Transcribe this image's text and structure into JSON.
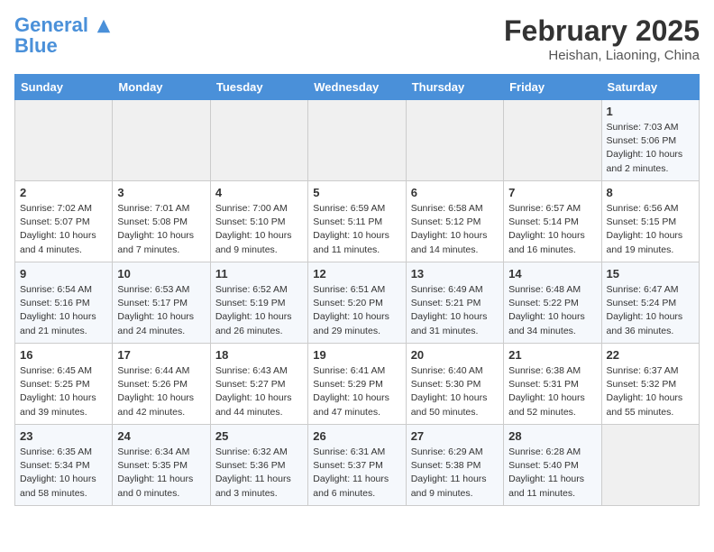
{
  "header": {
    "logo_line1": "General",
    "logo_line2": "Blue",
    "month_year": "February 2025",
    "location": "Heishan, Liaoning, China"
  },
  "weekdays": [
    "Sunday",
    "Monday",
    "Tuesday",
    "Wednesday",
    "Thursday",
    "Friday",
    "Saturday"
  ],
  "weeks": [
    [
      {
        "day": "",
        "empty": true
      },
      {
        "day": "",
        "empty": true
      },
      {
        "day": "",
        "empty": true
      },
      {
        "day": "",
        "empty": true
      },
      {
        "day": "",
        "empty": true
      },
      {
        "day": "",
        "empty": true
      },
      {
        "day": "1",
        "sunrise": "Sunrise: 7:03 AM",
        "sunset": "Sunset: 5:06 PM",
        "daylight": "Daylight: 10 hours and 2 minutes."
      }
    ],
    [
      {
        "day": "2",
        "sunrise": "Sunrise: 7:02 AM",
        "sunset": "Sunset: 5:07 PM",
        "daylight": "Daylight: 10 hours and 4 minutes."
      },
      {
        "day": "3",
        "sunrise": "Sunrise: 7:01 AM",
        "sunset": "Sunset: 5:08 PM",
        "daylight": "Daylight: 10 hours and 7 minutes."
      },
      {
        "day": "4",
        "sunrise": "Sunrise: 7:00 AM",
        "sunset": "Sunset: 5:10 PM",
        "daylight": "Daylight: 10 hours and 9 minutes."
      },
      {
        "day": "5",
        "sunrise": "Sunrise: 6:59 AM",
        "sunset": "Sunset: 5:11 PM",
        "daylight": "Daylight: 10 hours and 11 minutes."
      },
      {
        "day": "6",
        "sunrise": "Sunrise: 6:58 AM",
        "sunset": "Sunset: 5:12 PM",
        "daylight": "Daylight: 10 hours and 14 minutes."
      },
      {
        "day": "7",
        "sunrise": "Sunrise: 6:57 AM",
        "sunset": "Sunset: 5:14 PM",
        "daylight": "Daylight: 10 hours and 16 minutes."
      },
      {
        "day": "8",
        "sunrise": "Sunrise: 6:56 AM",
        "sunset": "Sunset: 5:15 PM",
        "daylight": "Daylight: 10 hours and 19 minutes."
      }
    ],
    [
      {
        "day": "9",
        "sunrise": "Sunrise: 6:54 AM",
        "sunset": "Sunset: 5:16 PM",
        "daylight": "Daylight: 10 hours and 21 minutes."
      },
      {
        "day": "10",
        "sunrise": "Sunrise: 6:53 AM",
        "sunset": "Sunset: 5:17 PM",
        "daylight": "Daylight: 10 hours and 24 minutes."
      },
      {
        "day": "11",
        "sunrise": "Sunrise: 6:52 AM",
        "sunset": "Sunset: 5:19 PM",
        "daylight": "Daylight: 10 hours and 26 minutes."
      },
      {
        "day": "12",
        "sunrise": "Sunrise: 6:51 AM",
        "sunset": "Sunset: 5:20 PM",
        "daylight": "Daylight: 10 hours and 29 minutes."
      },
      {
        "day": "13",
        "sunrise": "Sunrise: 6:49 AM",
        "sunset": "Sunset: 5:21 PM",
        "daylight": "Daylight: 10 hours and 31 minutes."
      },
      {
        "day": "14",
        "sunrise": "Sunrise: 6:48 AM",
        "sunset": "Sunset: 5:22 PM",
        "daylight": "Daylight: 10 hours and 34 minutes."
      },
      {
        "day": "15",
        "sunrise": "Sunrise: 6:47 AM",
        "sunset": "Sunset: 5:24 PM",
        "daylight": "Daylight: 10 hours and 36 minutes."
      }
    ],
    [
      {
        "day": "16",
        "sunrise": "Sunrise: 6:45 AM",
        "sunset": "Sunset: 5:25 PM",
        "daylight": "Daylight: 10 hours and 39 minutes."
      },
      {
        "day": "17",
        "sunrise": "Sunrise: 6:44 AM",
        "sunset": "Sunset: 5:26 PM",
        "daylight": "Daylight: 10 hours and 42 minutes."
      },
      {
        "day": "18",
        "sunrise": "Sunrise: 6:43 AM",
        "sunset": "Sunset: 5:27 PM",
        "daylight": "Daylight: 10 hours and 44 minutes."
      },
      {
        "day": "19",
        "sunrise": "Sunrise: 6:41 AM",
        "sunset": "Sunset: 5:29 PM",
        "daylight": "Daylight: 10 hours and 47 minutes."
      },
      {
        "day": "20",
        "sunrise": "Sunrise: 6:40 AM",
        "sunset": "Sunset: 5:30 PM",
        "daylight": "Daylight: 10 hours and 50 minutes."
      },
      {
        "day": "21",
        "sunrise": "Sunrise: 6:38 AM",
        "sunset": "Sunset: 5:31 PM",
        "daylight": "Daylight: 10 hours and 52 minutes."
      },
      {
        "day": "22",
        "sunrise": "Sunrise: 6:37 AM",
        "sunset": "Sunset: 5:32 PM",
        "daylight": "Daylight: 10 hours and 55 minutes."
      }
    ],
    [
      {
        "day": "23",
        "sunrise": "Sunrise: 6:35 AM",
        "sunset": "Sunset: 5:34 PM",
        "daylight": "Daylight: 10 hours and 58 minutes."
      },
      {
        "day": "24",
        "sunrise": "Sunrise: 6:34 AM",
        "sunset": "Sunset: 5:35 PM",
        "daylight": "Daylight: 11 hours and 0 minutes."
      },
      {
        "day": "25",
        "sunrise": "Sunrise: 6:32 AM",
        "sunset": "Sunset: 5:36 PM",
        "daylight": "Daylight: 11 hours and 3 minutes."
      },
      {
        "day": "26",
        "sunrise": "Sunrise: 6:31 AM",
        "sunset": "Sunset: 5:37 PM",
        "daylight": "Daylight: 11 hours and 6 minutes."
      },
      {
        "day": "27",
        "sunrise": "Sunrise: 6:29 AM",
        "sunset": "Sunset: 5:38 PM",
        "daylight": "Daylight: 11 hours and 9 minutes."
      },
      {
        "day": "28",
        "sunrise": "Sunrise: 6:28 AM",
        "sunset": "Sunset: 5:40 PM",
        "daylight": "Daylight: 11 hours and 11 minutes."
      },
      {
        "day": "",
        "empty": true
      }
    ]
  ]
}
